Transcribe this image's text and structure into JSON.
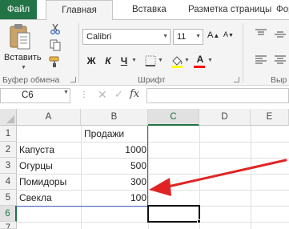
{
  "ribbon_tabs": {
    "file": "Файл",
    "home": "Главная",
    "insert": "Вставка",
    "page_layout": "Разметка страницы",
    "formulas": "Форм"
  },
  "clipboard_group": {
    "paste_label": "Вставить",
    "group_label": "Буфер обмена"
  },
  "font_group": {
    "font_name": "Calibri",
    "font_size": "11",
    "bold": "Ж",
    "italic": "К",
    "underline": "Ч",
    "font_color_letter": "А",
    "group_label": "Шрифт"
  },
  "alignment_group": {
    "group_label": "Выр"
  },
  "formula_bar": {
    "name_box": "C6",
    "fx": "fx",
    "formula": ""
  },
  "grid": {
    "columns": [
      "A",
      "B",
      "C",
      "D",
      "E"
    ],
    "rows": [
      "1",
      "2",
      "3",
      "4",
      "5",
      "6",
      "7"
    ],
    "selected_column": "C",
    "selected_row": "6",
    "cells": {
      "B1": "Продажи",
      "A2": "Капуста",
      "B2": "1000",
      "A3": "Огурцы",
      "B3": "500",
      "A4": "Помидоры",
      "B4": "300",
      "A5": "Свекла",
      "B5": "100"
    }
  },
  "colors": {
    "excel_green": "#217346",
    "file_tab": "#227447",
    "arrow": "#e02424",
    "annotation_line": "#3a58c8",
    "font_color_bar": "#ff0000",
    "highlight_bar": "#ffff00"
  }
}
